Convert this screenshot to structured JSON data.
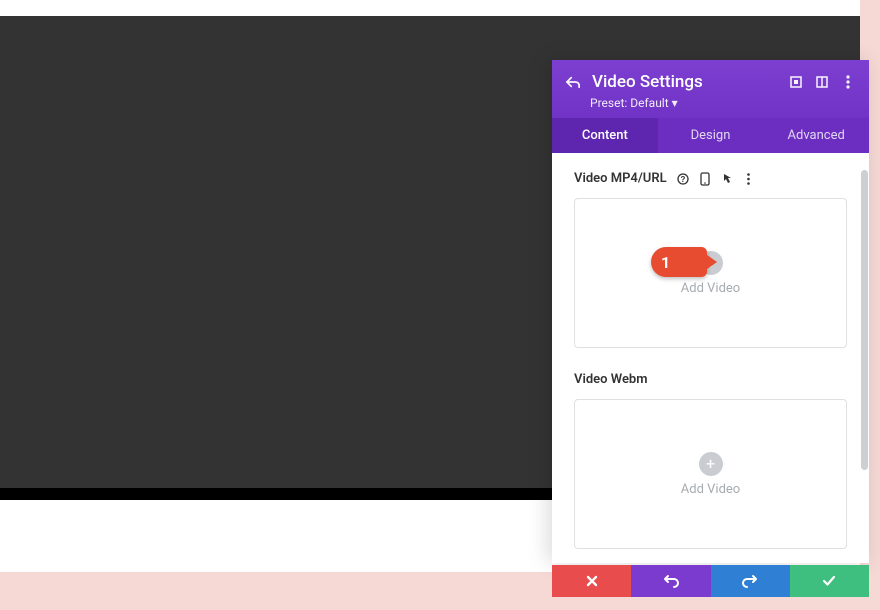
{
  "header": {
    "title": "Video Settings",
    "preset": "Preset: Default ▾"
  },
  "tabs": {
    "content": "Content",
    "design": "Design",
    "advanced": "Advanced"
  },
  "fields": {
    "mp4": {
      "label": "Video MP4/URL",
      "add_label": "Add Video"
    },
    "webm": {
      "label": "Video Webm",
      "add_label": "Add Video"
    }
  },
  "annotation": {
    "number": "1"
  }
}
